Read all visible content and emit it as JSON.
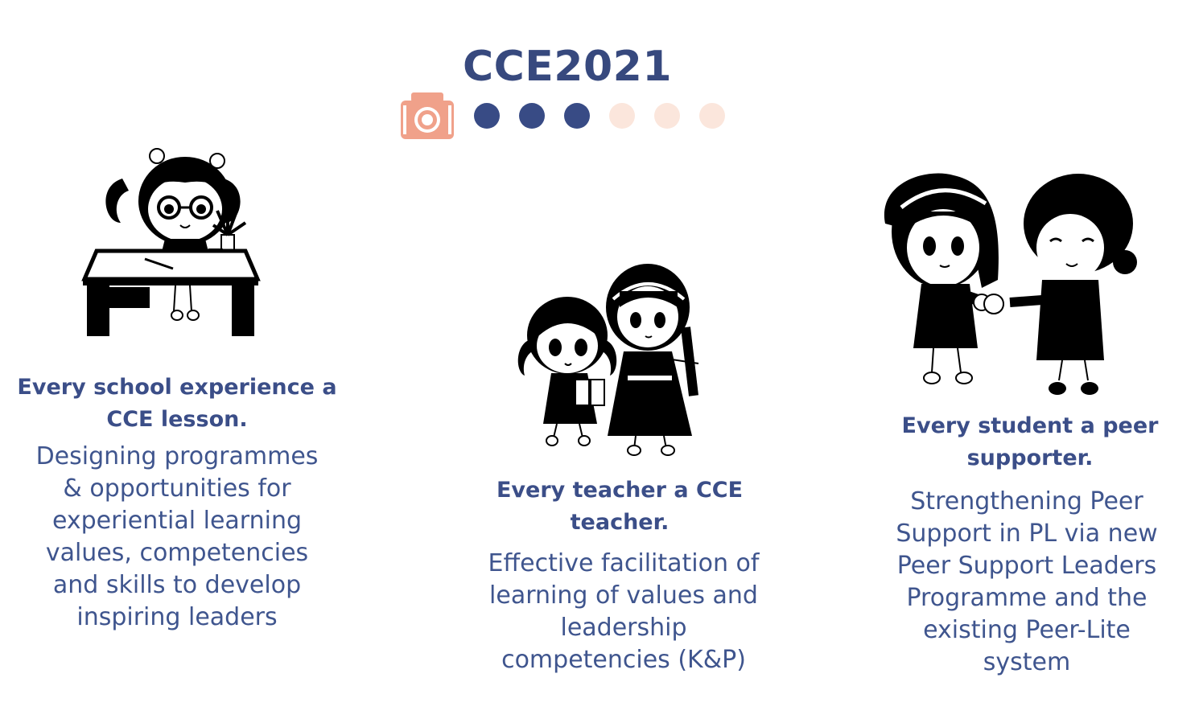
{
  "title": "CCE2021",
  "indicator": {
    "icon": "camera-icon",
    "filled_count": 3,
    "total_dots": 6,
    "colors": {
      "camera": "#f0a18a",
      "filled": "#384b85",
      "empty": "#fbe6dc"
    }
  },
  "columns": [
    {
      "heading": "Every school experience a CCE lesson.",
      "body": "Designing programmes & opportunities for experiential learning values, competencies and skills to develop inspiring leaders",
      "illustration": "girl-at-desk-illustration"
    },
    {
      "heading": "Every teacher a CCE teacher.",
      "body": "Effective facilitation of learning of values and leadership competencies (K&P)",
      "illustration": "teacher-with-child-illustration"
    },
    {
      "heading": "Every student a peer supporter.",
      "body": "Strengthening Peer Support in PL via new Peer Support Leaders Programme and the existing Peer-Lite system",
      "illustration": "peer-support-illustration"
    }
  ],
  "colors": {
    "title": "#37497e",
    "text": "#3b4e88"
  }
}
